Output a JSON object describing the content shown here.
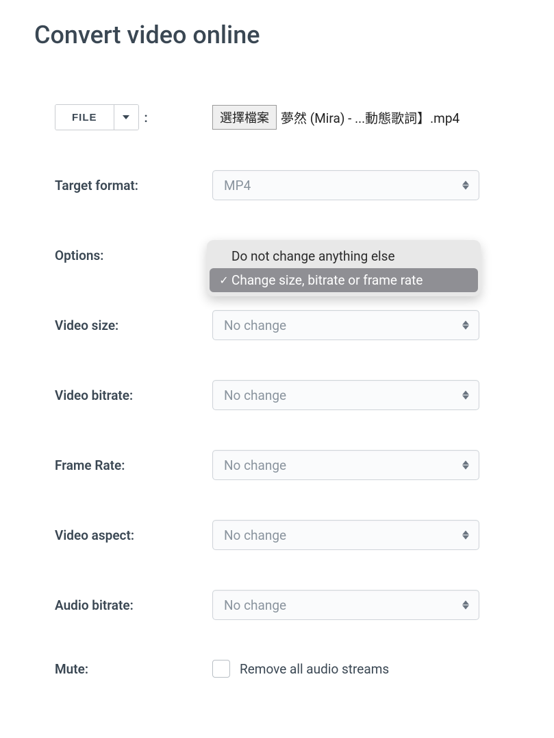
{
  "page_title": "Convert video online",
  "file": {
    "button_label": "FILE",
    "choose_button": "選擇檔案",
    "selected_name": "夢然 (Mira) - ...動態歌詞】.mp4"
  },
  "fields": {
    "target_format": {
      "label": "Target format:",
      "value": "MP4"
    },
    "options": {
      "label": "Options:",
      "items": [
        {
          "text": "Do not change anything else",
          "selected": false
        },
        {
          "text": "Change size, bitrate or frame rate",
          "selected": true
        }
      ]
    },
    "video_size": {
      "label": "Video size:",
      "value": "No change"
    },
    "video_bitrate": {
      "label": "Video bitrate:",
      "value": "No change"
    },
    "frame_rate": {
      "label": "Frame Rate:",
      "value": "No change"
    },
    "video_aspect": {
      "label": "Video aspect:",
      "value": "No change"
    },
    "audio_bitrate": {
      "label": "Audio bitrate:",
      "value": "No change"
    },
    "mute": {
      "label": "Mute:",
      "checkbox_label": "Remove all audio streams",
      "checked": false
    }
  }
}
